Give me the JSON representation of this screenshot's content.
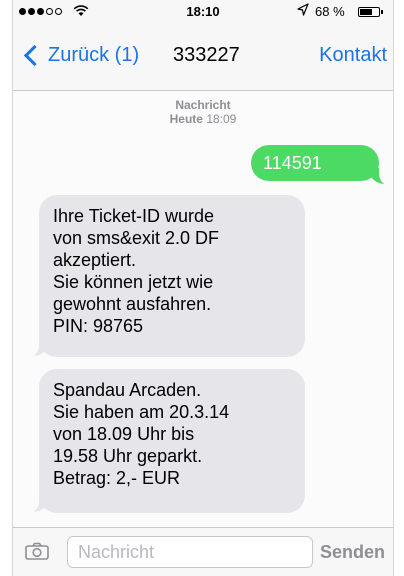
{
  "status_bar": {
    "signal_total": 5,
    "signal_filled": 3,
    "wifi_icon": "wifi-icon",
    "time": "18:10",
    "location_icon": "location-arrow-icon",
    "battery_text": "68 %",
    "battery_level": 0.68
  },
  "nav": {
    "back_label": "Zurück (1)",
    "title": "333227",
    "contact_label": "Kontakt",
    "accent_color": "#1a73e8"
  },
  "conversation": {
    "header_label": "Nachricht",
    "date_day": "Heute",
    "date_time": "18:09",
    "messages": [
      {
        "direction": "sent",
        "lines": [
          "114591"
        ]
      },
      {
        "direction": "received",
        "lines": [
          "Ihre Ticket-ID wurde",
          "von sms&exit 2.0 DF",
          "akzeptiert.",
          "Sie können jetzt wie",
          "gewohnt ausfahren.",
          "PIN: 98765"
        ]
      },
      {
        "direction": "received",
        "lines": [
          "Spandau Arcaden.",
          "Sie haben am 20.3.14",
          "von 18.09 Uhr bis",
          "19.58 Uhr geparkt.",
          "Betrag: 2,- EUR"
        ]
      }
    ],
    "sent_color": "#4cd964",
    "received_color": "#e5e5ea"
  },
  "input_bar": {
    "camera_icon": "camera-icon",
    "placeholder": "Nachricht",
    "value": "",
    "send_label": "Senden"
  }
}
